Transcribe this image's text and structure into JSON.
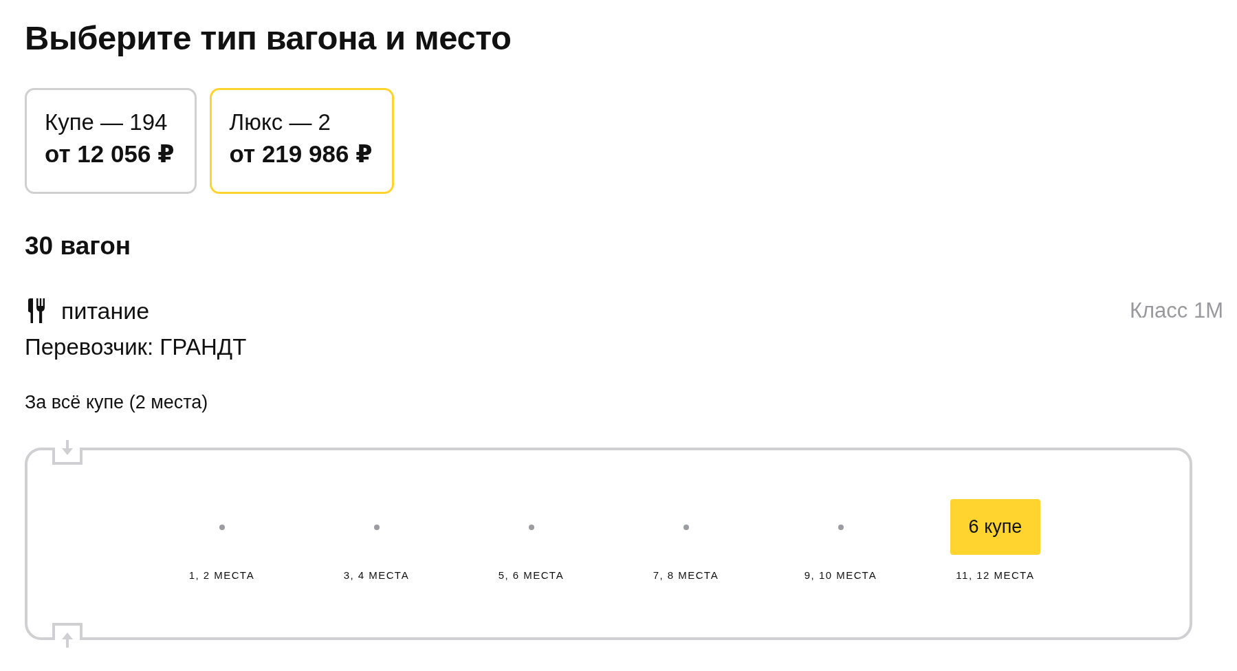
{
  "title": "Выберите тип вагона и место",
  "car_types": [
    {
      "name": "Купе — 194",
      "price": "от 12 056 ₽",
      "selected": false
    },
    {
      "name": "Люкс — 2",
      "price": "от 219 986 ₽",
      "selected": true
    }
  ],
  "car": {
    "number": "30 вагон",
    "amenities": [
      {
        "kind": "food",
        "label": "питание"
      }
    ],
    "class": "Класс 1М",
    "carrier": "Перевозчик: ГРАНДТ"
  },
  "section_label": "За всё купе (2 места)",
  "compartments": [
    {
      "seats": "1, 2 МЕСТА",
      "available": false
    },
    {
      "seats": "3, 4 МЕСТА",
      "available": false
    },
    {
      "seats": "5, 6 МЕСТА",
      "available": false
    },
    {
      "seats": "7, 8 МЕСТА",
      "available": false
    },
    {
      "seats": "9, 10 МЕСТА",
      "available": false
    },
    {
      "label": "6 купе",
      "seats": "11, 12 МЕСТА",
      "available": true
    }
  ]
}
